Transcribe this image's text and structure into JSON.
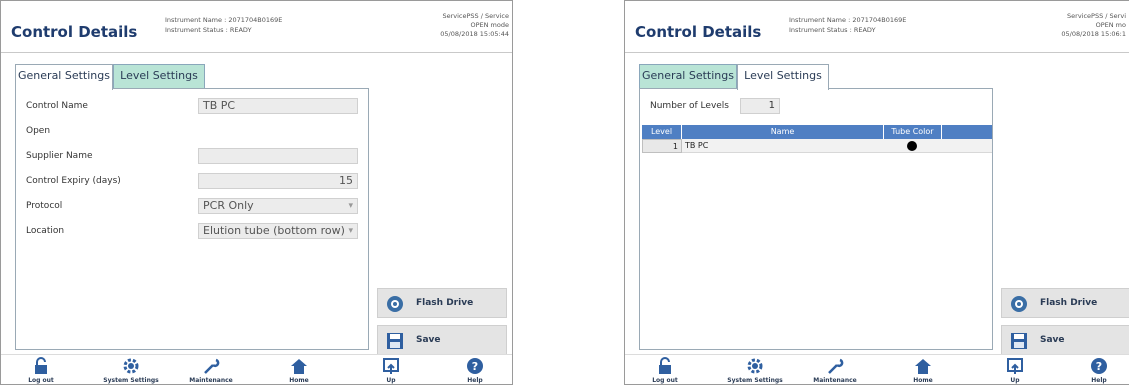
{
  "left_panel": {
    "header": {
      "title": "Control Details",
      "instrument_name": "Instrument Name : 2071704B0169E",
      "instrument_status": "Instrument Status : READY",
      "user_line1": "ServicePSS / Service",
      "user_line2": "OPEN mode",
      "datetime": "05/08/2018 15:05:44"
    },
    "tabs": [
      {
        "label": "General Settings",
        "active": true
      },
      {
        "label": "Level Settings",
        "active": false
      }
    ],
    "form": {
      "control_name_label": "Control Name",
      "control_name_value": "TB PC",
      "open_label": "Open",
      "supplier_name_label": "Supplier Name",
      "supplier_name_value": "",
      "expiry_label": "Control Expiry (days)",
      "expiry_value": "15",
      "protocol_label": "Protocol",
      "protocol_value": "PCR Only",
      "location_label": "Location",
      "location_value": "Elution tube (bottom row)"
    },
    "side_buttons": {
      "flash_drive": "Flash Drive",
      "save": "Save"
    },
    "bottom_bar": [
      "Log out",
      "System Settings",
      "Maintenance",
      "Home",
      "Up",
      "Help"
    ]
  },
  "right_panel": {
    "header": {
      "title": "Control Details",
      "instrument_name": "Instrument Name : 2071704B0169E",
      "instrument_status": "Instrument Status : READY",
      "user_line1": "ServicePSS / Servi",
      "user_line2": "OPEN mo",
      "datetime": "05/08/2018 15:06:1"
    },
    "tabs": [
      {
        "label": "General Settings",
        "active": false
      },
      {
        "label": "Level Settings",
        "active": true
      }
    ],
    "levels": {
      "number_label": "Number of Levels",
      "number_value": "1",
      "columns": [
        "Level",
        "Name",
        "Tube Color"
      ],
      "rows": [
        {
          "level": "1",
          "name": "TB PC",
          "tube_color": "#000000"
        }
      ]
    },
    "side_buttons": {
      "flash_drive": "Flash Drive",
      "save": "Save"
    },
    "bottom_bar": [
      "Log out",
      "System Settings",
      "Maintenance",
      "Home",
      "Up",
      "Help"
    ]
  },
  "colors": {
    "title": "#1f3c6e",
    "tab_inactive": "#b9e4d6",
    "table_header": "#4f7fc3",
    "button_bg": "#e4e4e4"
  }
}
